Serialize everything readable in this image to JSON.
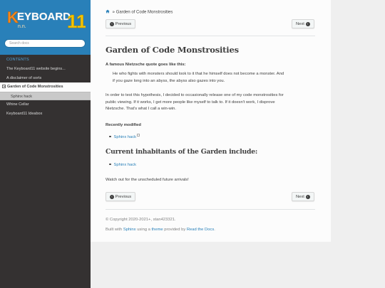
{
  "sidebar": {
    "logo_text": "Keyboard11",
    "logo_sub": "n.n.",
    "search_placeholder": "Search docs",
    "caption": "CONTENTS",
    "items": [
      {
        "label": "The Keyboard11 website begins..."
      },
      {
        "label": "A disclaimer of sorts"
      },
      {
        "label": "Garden of Code Monstrosities"
      },
      {
        "label": "Sphinx hack"
      },
      {
        "label": "Whine Cellar"
      },
      {
        "label": "Keyboard11 Ideabox"
      }
    ]
  },
  "breadcrumb": {
    "separator": "»",
    "current": "Garden of Code Monstrosities"
  },
  "nav_buttons": {
    "previous": "Previous",
    "next": "Next"
  },
  "page": {
    "title": "Garden of Code Monstrosities",
    "quote_intro": "A famous Nietzsche quote goes like this:",
    "quote_line1": "He who fights with monsters should look to it that he himself does not become a monster. And",
    "quote_line2": "if you gaze long into an abyss, the abyss also gazes into you.",
    "para_line1": "In order to test this hypothesis, I decided to occasionally release one of my code monstrosities for",
    "para_line2": "public viewing. If it works, I get more people like myself to talk to. If it doesn't work, I disprove",
    "para_line3": "Nietzsche. That's what I call a win-win.",
    "recent_heading": "Recently modified",
    "recent_link": "Sphinx hack",
    "inhabitants_heading": "Current inhabitants of the Garden include:",
    "inhabitant_link": "Sphinx hack",
    "closing": "Watch out for the unscheduled future arrivals!"
  },
  "footer": {
    "copyright": "© Copyright 2020-2021+, stan423321.",
    "built_prefix": "Built with",
    "sphinx": "Sphinx",
    "using_a": "using a",
    "theme": "theme",
    "provided_by": "provided by",
    "rtd": "Read the Docs",
    "period": "."
  },
  "colors": {
    "sidebar_bg": "#343131",
    "sidebar_top": "#2980b9",
    "link": "#2980b9",
    "logo_orange": "#f08a24",
    "logo_yellow": "#f5c400"
  },
  "icons": {
    "home": "home-icon",
    "prev": "arrow-circle-left-icon",
    "next": "arrow-circle-right-icon",
    "external": "external-link-icon"
  }
}
